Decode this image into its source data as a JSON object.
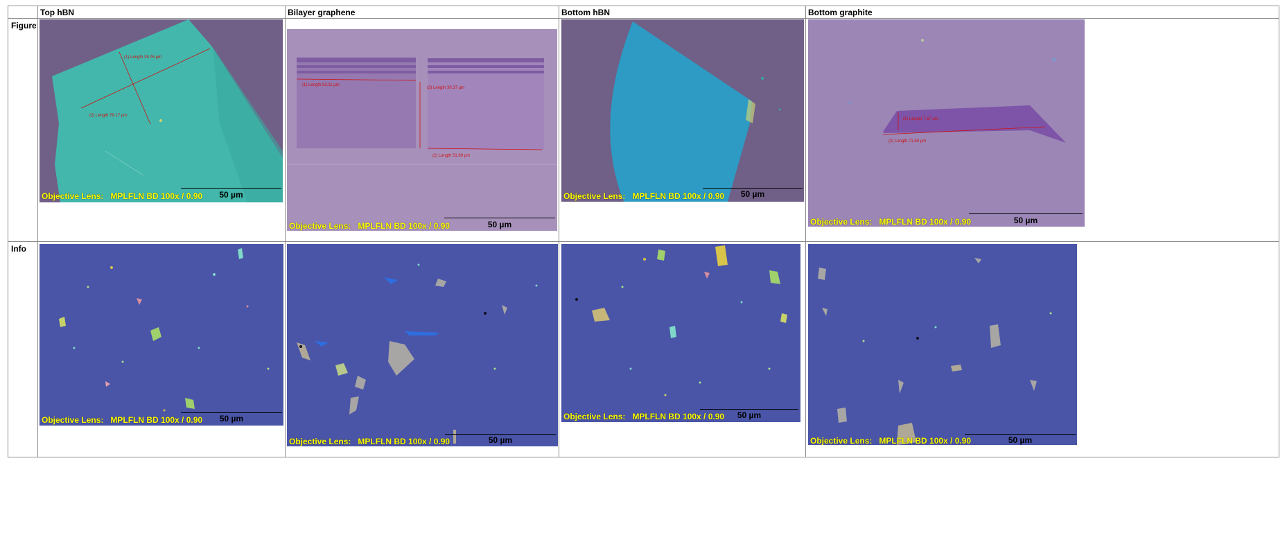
{
  "table": {
    "columns": [
      "Top hBN",
      "Bilayer graphene",
      "Bottom hBN",
      "Bottom graphite"
    ],
    "rows": [
      "Figure",
      "Info"
    ]
  },
  "microscope": {
    "lens_label": "Objective Lens:",
    "lens_value": "MPLFLN BD 100x / 0.90",
    "scale_bar": "50 µm"
  },
  "figure_measurements": {
    "top_hbn": [
      "(1) Length 39.76 µm",
      "(2) Length 79.17 µm"
    ],
    "bilayer_graphene": [
      "(1) Length 53.11 µm",
      "(3) Length 30.37 µm",
      "(2) Length 51.60 µm"
    ],
    "bottom_graphite": [
      "(1) Length 7.67 µm",
      "(2) Length 71.60 µm"
    ]
  },
  "colors": {
    "substrate_purple": "#705f87",
    "hbn_cyan": "#43b7ac",
    "bilayer_lilac": "#9d86b3",
    "bottom_hbn_blue": "#2d9bc4",
    "info_blue": "#4a55a8",
    "lens_text": "#ffff00",
    "measure_red": "#d01010"
  }
}
